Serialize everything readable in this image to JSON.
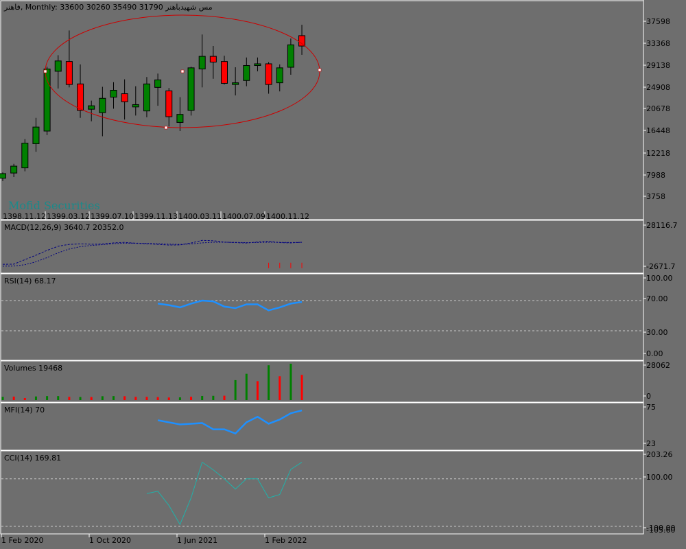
{
  "main": {
    "header": "فاهنر, Monthly:  33600 30260 35490 31790  مس شهیدباهنر",
    "watermark": "Mofid Securities",
    "y_ticks": [
      "37598",
      "33368",
      "29138",
      "24908",
      "20678",
      "16448",
      "12218",
      "7988",
      "3758"
    ],
    "date_ticks": [
      "1398.11.12",
      "1399.03.12",
      "1399.07.10",
      "1399.11.13",
      "1400.03.11",
      "1400.07.09",
      "1400.11.12"
    ],
    "bull_color": "#008000",
    "bear_color": "#ff0000",
    "ellipse_color": "#cc0000"
  },
  "macd": {
    "label": "MACD(12,26,9) 3640.7 20352.0",
    "ticks": [
      "28116.7",
      "-2671.7"
    ],
    "line_color": "#000080"
  },
  "rsi": {
    "label": "RSI(14) 68.17",
    "ticks": [
      "100.00",
      "70.00",
      "30.00",
      "0.00"
    ],
    "line_color": "#1e90ff"
  },
  "volumes": {
    "label": "Volumes 19468",
    "ticks": [
      "28062",
      "0"
    ]
  },
  "mfi": {
    "label": "MFI(14) 70",
    "ticks": [
      "75",
      "23"
    ],
    "line_color": "#1e90ff"
  },
  "cci": {
    "label": "CCI(14) 169.81",
    "ticks": [
      "203.26",
      "100.00",
      "-100.00",
      "-105.60"
    ],
    "line_color": "#20b2aa"
  },
  "time_axis": [
    "1 Feb 2020",
    "1 Oct 2020",
    "1 Jun 2021",
    "1 Feb 2022"
  ],
  "chart_data": [
    {
      "type": "candlestick",
      "title": "فاهنر, Monthly",
      "ohlc": [
        [
          8800,
          9800,
          8300,
          9600
        ],
        [
          9700,
          11300,
          9000,
          10900
        ],
        [
          10600,
          15600,
          10000,
          14900
        ],
        [
          14800,
          19300,
          13400,
          17700
        ],
        [
          17000,
          28200,
          16300,
          27800
        ],
        [
          27400,
          30200,
          24400,
          29200
        ],
        [
          29100,
          34500,
          24600,
          25100
        ],
        [
          25200,
          28600,
          19300,
          20600
        ],
        [
          20800,
          22300,
          18700,
          21400
        ],
        [
          20200,
          24700,
          16100,
          22700
        ],
        [
          22900,
          25500,
          20900,
          24100
        ],
        [
          23500,
          26000,
          19000,
          22100
        ],
        [
          21200,
          24800,
          19700,
          21600
        ],
        [
          20500,
          26400,
          19400,
          25200
        ],
        [
          24600,
          27000,
          21400,
          25900
        ],
        [
          24000,
          24500,
          17800,
          19500
        ],
        [
          18500,
          22900,
          17000,
          19900
        ],
        [
          20600,
          28200,
          19700,
          28000
        ],
        [
          27800,
          33800,
          24600,
          30000
        ],
        [
          30000,
          31800,
          26100,
          29000
        ],
        [
          29100,
          30100,
          25100,
          25300
        ],
        [
          25100,
          28100,
          23200,
          25400
        ],
        [
          25800,
          29800,
          24800,
          28400
        ],
        [
          28400,
          29800,
          27400,
          28700
        ],
        [
          28700,
          29000,
          23500,
          25100
        ],
        [
          25400,
          28600,
          23900,
          28000
        ],
        [
          28100,
          33100,
          26800,
          32000
        ],
        [
          33600,
          35490,
          30260,
          31790
        ]
      ],
      "ylim": [
        1600,
        39800
      ]
    },
    {
      "type": "line",
      "title": "MACD(12,26,9)",
      "ylim": [
        -2671.7,
        28116.7
      ],
      "series": [
        {
          "name": "MACD",
          "values": [
            -1200,
            -1100,
            2300,
            5600,
            9200,
            12300,
            13700,
            14100,
            13800,
            14000,
            14800,
            15200,
            14500,
            14100,
            13700,
            13200,
            13300,
            14700,
            16700,
            16400,
            15400,
            15000,
            14700,
            15500,
            16000,
            15000,
            14800,
            15300
          ]
        },
        {
          "name": "Signal",
          "values": [
            -2600,
            -2500,
            -1500,
            700,
            3800,
            7400,
            10200,
            12000,
            12900,
            13500,
            14200,
            14600,
            14600,
            14400,
            14200,
            13900,
            13700,
            14000,
            14800,
            15300,
            15300,
            15200,
            15000,
            15100,
            15300,
            15200,
            15100,
            15200
          ]
        }
      ],
      "histogram": [
        null,
        null,
        null,
        null,
        null,
        null,
        null,
        null,
        null,
        null,
        null,
        null,
        null,
        null,
        null,
        null,
        null,
        null,
        null,
        null,
        null,
        null,
        null,
        null,
        -300,
        -200,
        -300,
        0
      ]
    },
    {
      "type": "line",
      "title": "RSI(14)",
      "ylim": [
        0,
        100
      ],
      "levels": [
        70,
        30
      ],
      "values": [
        null,
        null,
        null,
        null,
        null,
        null,
        null,
        null,
        null,
        null,
        null,
        null,
        null,
        null,
        66,
        64,
        61,
        66,
        70,
        69,
        62,
        60,
        65,
        65,
        57,
        61,
        66,
        68.17
      ]
    },
    {
      "type": "bar",
      "title": "Volumes",
      "ylim": [
        0,
        28062
      ],
      "values": [
        2500,
        2700,
        1600,
        2800,
        3100,
        3100,
        2500,
        2400,
        2400,
        3000,
        3100,
        3000,
        2500,
        2500,
        2300,
        2000,
        2100,
        2600,
        3200,
        3300,
        3400,
        15400,
        20300,
        14600,
        26900,
        18400,
        28062,
        19468
      ],
      "colors": [
        "g",
        "r",
        "r",
        "g",
        "g",
        "g",
        "r",
        "g",
        "r",
        "g",
        "g",
        "r",
        "r",
        "r",
        "r",
        "r",
        "g",
        "r",
        "g",
        "g",
        "r",
        "g",
        "g",
        "r",
        "g",
        "r",
        "g",
        "r"
      ]
    },
    {
      "type": "line",
      "title": "MFI(14)",
      "ylim": [
        23,
        75
      ],
      "values": [
        null,
        null,
        null,
        null,
        null,
        null,
        null,
        null,
        null,
        null,
        null,
        null,
        null,
        null,
        56,
        53,
        50,
        51,
        52,
        43,
        43,
        37,
        53,
        61,
        51,
        57,
        66,
        70
      ]
    },
    {
      "type": "line",
      "title": "CCI(14)",
      "ylim": [
        -105.6,
        203.26
      ],
      "levels": [
        100,
        -100
      ],
      "values": [
        null,
        null,
        null,
        null,
        null,
        null,
        null,
        null,
        null,
        null,
        null,
        null,
        null,
        38,
        48,
        -12,
        -92,
        20,
        170,
        138,
        100,
        57,
        100,
        100,
        20,
        34,
        140,
        169.81
      ]
    }
  ]
}
